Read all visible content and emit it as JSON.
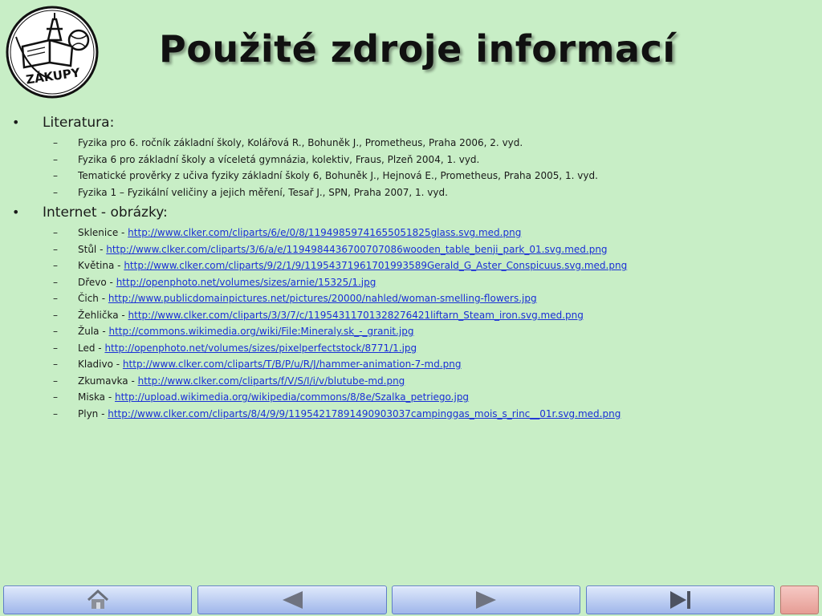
{
  "logo": {
    "icon": "zakupy-school-logo",
    "text": "ZÁKUPY"
  },
  "title": "Použité zdroje informací",
  "sections": [
    {
      "label": "Literatura:",
      "items": [
        {
          "text": "Fyzika pro 6. ročník základní školy, Kolářová R., Bohuněk J., Prometheus, Praha 2006, 2. vyd.",
          "link": ""
        },
        {
          "text": "Fyzika 6 pro základní školy a víceletá gymnázia, kolektiv, Fraus, Plzeň 2004, 1. vyd.",
          "link": ""
        },
        {
          "text": "Tematické prověrky z učiva fyziky základní školy 6, Bohuněk J., Hejnová E., Prometheus, Praha 2005, 1. vyd.",
          "link": ""
        },
        {
          "text": "Fyzika 1 – Fyzikální veličiny a jejich měření, Tesař J., SPN, Praha 2007, 1. vyd.",
          "link": ""
        }
      ]
    },
    {
      "label": "Internet - obrázky:",
      "items": [
        {
          "text": "Sklenice - ",
          "link": "http://www.clker.com/cliparts/6/e/0/8/11949859741655051825glass.svg.med.png"
        },
        {
          "text": "Stůl - ",
          "link": "http://www.clker.com/cliparts/3/6/a/e/1194984436700707086wooden_table_benji_park_01.svg.med.png"
        },
        {
          "text": "Květina - ",
          "link": "http://www.clker.com/cliparts/9/2/1/9/11954371961701993589Gerald_G_Aster_Conspicuus.svg.med.png"
        },
        {
          "text": "Dřevo - ",
          "link": "http://openphoto.net/volumes/sizes/arnie/15325/1.jpg"
        },
        {
          "text": "Čich - ",
          "link": "http://www.publicdomainpictures.net/pictures/20000/nahled/woman-smelling-flowers.jpg"
        },
        {
          "text": "Žehlička - ",
          "link": "http://www.clker.com/cliparts/3/3/7/c/11954311701328276421liftarn_Steam_iron.svg.med.png"
        },
        {
          "text": "Žula - ",
          "link": "http://commons.wikimedia.org/wiki/File:Mineraly.sk_-_granit.jpg"
        },
        {
          "text": "Led - ",
          "link": "http://openphoto.net/volumes/sizes/pixelperfectstock/8771/1.jpg"
        },
        {
          "text": "Kladivo - ",
          "link": "http://www.clker.com/cliparts/T/B/P/u/R/J/hammer-animation-7-md.png"
        },
        {
          "text": "Zkumavka - ",
          "link": "http://www.clker.com/cliparts/f/V/S/I/i/v/blutube-md.png"
        },
        {
          "text": "Miska - ",
          "link": "http://upload.wikimedia.org/wikipedia/commons/8/8e/Szalka_petriego.jpg"
        },
        {
          "text": "Plyn - ",
          "link": "http://www.clker.com/cliparts/8/4/9/9/11954217891490903037campinggas_mois_s_rinc__01r.svg.med.png"
        }
      ]
    }
  ],
  "nav": {
    "buttons": [
      {
        "name": "home-button",
        "icon": "home-icon"
      },
      {
        "name": "previous-button",
        "icon": "arrow-left-icon"
      },
      {
        "name": "next-button",
        "icon": "arrow-right-icon"
      },
      {
        "name": "last-slide-button",
        "icon": "skip-to-end-icon"
      },
      {
        "name": "close-button",
        "icon": "close-icon"
      }
    ]
  },
  "colors": {
    "background": "#c8eec6",
    "link": "#1a2fd6",
    "nav_button": "#b9cdf2",
    "close_button": "#eeb2ab"
  }
}
